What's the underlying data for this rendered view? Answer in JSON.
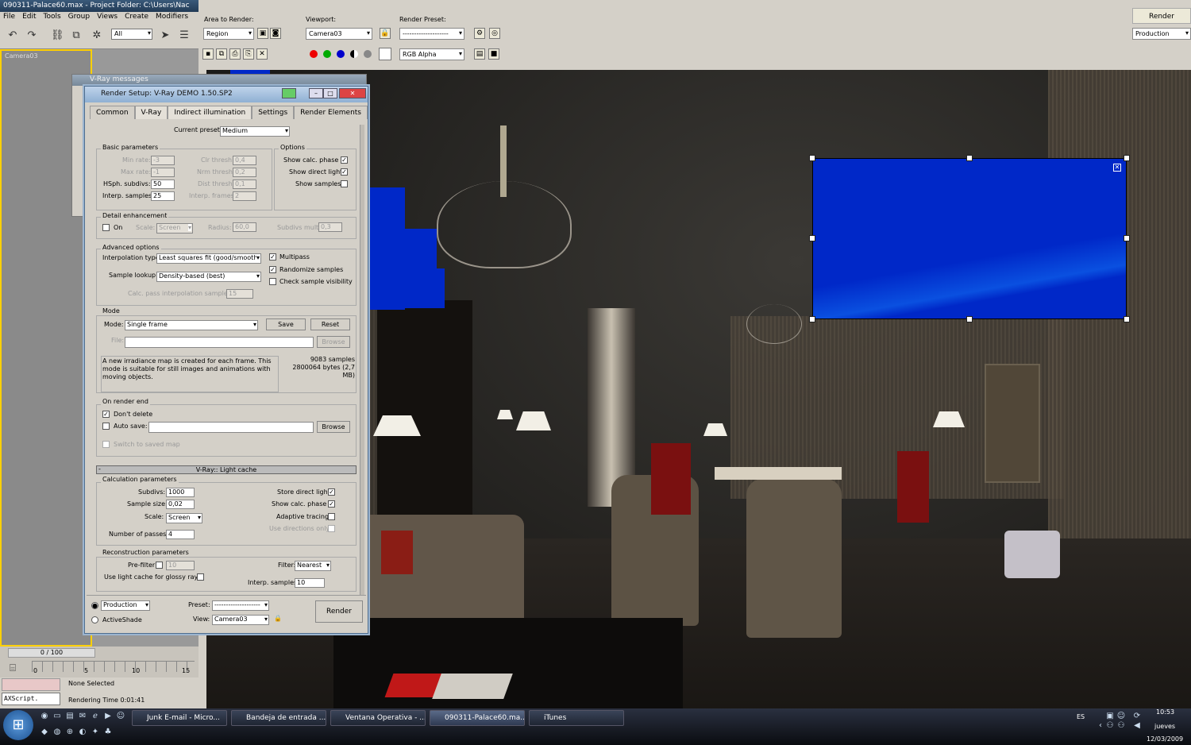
{
  "max": {
    "title": "090311-Palace60.max    - Project Folder: C:\\Users\\Nac",
    "menu": [
      "File",
      "Edit",
      "Tools",
      "Group",
      "Views",
      "Create",
      "Modifiers"
    ],
    "selection_filter": "All",
    "viewport_label": "Camera03",
    "frame_counter": "0 / 100",
    "ticks": [
      "0",
      "5",
      "10",
      "15"
    ],
    "status_selection": "None Selected",
    "status_render_time": "Rendering Time  0:01:41",
    "maxscript": "AXScript."
  },
  "framebuffer": {
    "area_label": "Area to Render:",
    "area_value": "Region",
    "viewport_label": "Viewport:",
    "viewport_value": "Camera03",
    "preset_label": "Render Preset:",
    "preset_value": "--------------------",
    "render_button": "Render",
    "production_value": "Production",
    "channel_value": "RGB Alpha",
    "region_color": "#0028c8"
  },
  "vray_messages": {
    "title": "V-Ray messages"
  },
  "render_setup": {
    "title": "Render Setup: V-Ray DEMO 1.50.SP2",
    "tabs": [
      "Common",
      "V-Ray",
      "Indirect illumination",
      "Settings",
      "Render Elements"
    ],
    "current_preset_label": "Current preset:",
    "current_preset": "Medium",
    "basic": {
      "title": "Basic parameters",
      "min_rate_label": "Min rate:",
      "min_rate": "-3",
      "max_rate_label": "Max rate:",
      "max_rate": "-1",
      "hsph_label": "HSph. subdivs:",
      "hsph": "50",
      "interp_label": "Interp. samples:",
      "interp": "25",
      "clr_label": "Clr thresh:",
      "clr": "0,4",
      "nrm_label": "Nrm thresh:",
      "nrm": "0,2",
      "dist_label": "Dist thresh:",
      "dist": "0,1",
      "frames_label": "Interp. frames:",
      "frames": "2"
    },
    "options": {
      "title": "Options",
      "calc_phase": "Show calc. phase",
      "direct_light": "Show direct light",
      "samples": "Show samples"
    },
    "detail": {
      "title": "Detail enhancement",
      "on_label": "On",
      "scale_label": "Scale:",
      "scale": "Screen",
      "radius_label": "Radius:",
      "radius": "60,0",
      "subdivs_label": "Subdivs mult.",
      "subdivs": "0,3"
    },
    "advanced": {
      "title": "Advanced options",
      "interp_type_label": "Interpolation type:",
      "interp_type": "Least squares fit (good/smooth",
      "lookup_label": "Sample lookup:",
      "lookup": "Density-based (best)",
      "calc_pass_label": "Calc. pass interpolation samples:",
      "calc_pass": "15",
      "multipass": "Multipass",
      "randomize": "Randomize samples",
      "check_vis": "Check sample visibility"
    },
    "mode": {
      "title": "Mode",
      "mode_label": "Mode:",
      "mode": "Single frame",
      "save": "Save",
      "reset": "Reset",
      "file_label": "File:",
      "browse": "Browse",
      "desc": "A new irradiance map is created for each frame. This mode is suitable for still images and animations with moving objects.",
      "stats": "9083 samples 2800064 bytes (2,7 MB)"
    },
    "render_end": {
      "title": "On render end",
      "dont_delete": "Don't delete",
      "auto_save": "Auto save:",
      "browse": "Browse",
      "switch": "Switch to saved map"
    },
    "lc_rollout": "V-Ray:: Light cache",
    "lc_collapse": "-",
    "calc": {
      "title": "Calculation parameters",
      "subdivs_label": "Subdivs:",
      "subdivs": "1000",
      "sample_size_label": "Sample size:",
      "sample_size": "0,02",
      "scale_label": "Scale:",
      "scale": "Screen",
      "passes_label": "Number of passes:",
      "passes": "4",
      "store_direct": "Store direct light",
      "show_calc": "Show calc. phase",
      "adaptive": "Adaptive tracing",
      "use_dirs": "Use directions only"
    },
    "recon": {
      "title": "Reconstruction parameters",
      "prefilter_label": "Pre-filter:",
      "prefilter": "10",
      "glossy_label": "Use light cache for glossy rays",
      "filter_label": "Filter:",
      "filter": "Nearest",
      "interp_label": "Interp. samples:",
      "interp": "10"
    },
    "footer": {
      "production": "Production",
      "activeshade": "ActiveShade",
      "preset_label": "Preset:",
      "preset": "--------------------",
      "view_label": "View:",
      "view": "Camera03",
      "render": "Render"
    }
  },
  "taskbar": {
    "tasks": [
      "Junk E-mail - Micro...",
      "Bandeja de entrada ...",
      "Ventana Operativa - ...",
      "090311-Palace60.ma...",
      "iTunes"
    ],
    "lang": "ES",
    "time": "10:53",
    "day": "jueves",
    "date": "12/03/2009"
  }
}
